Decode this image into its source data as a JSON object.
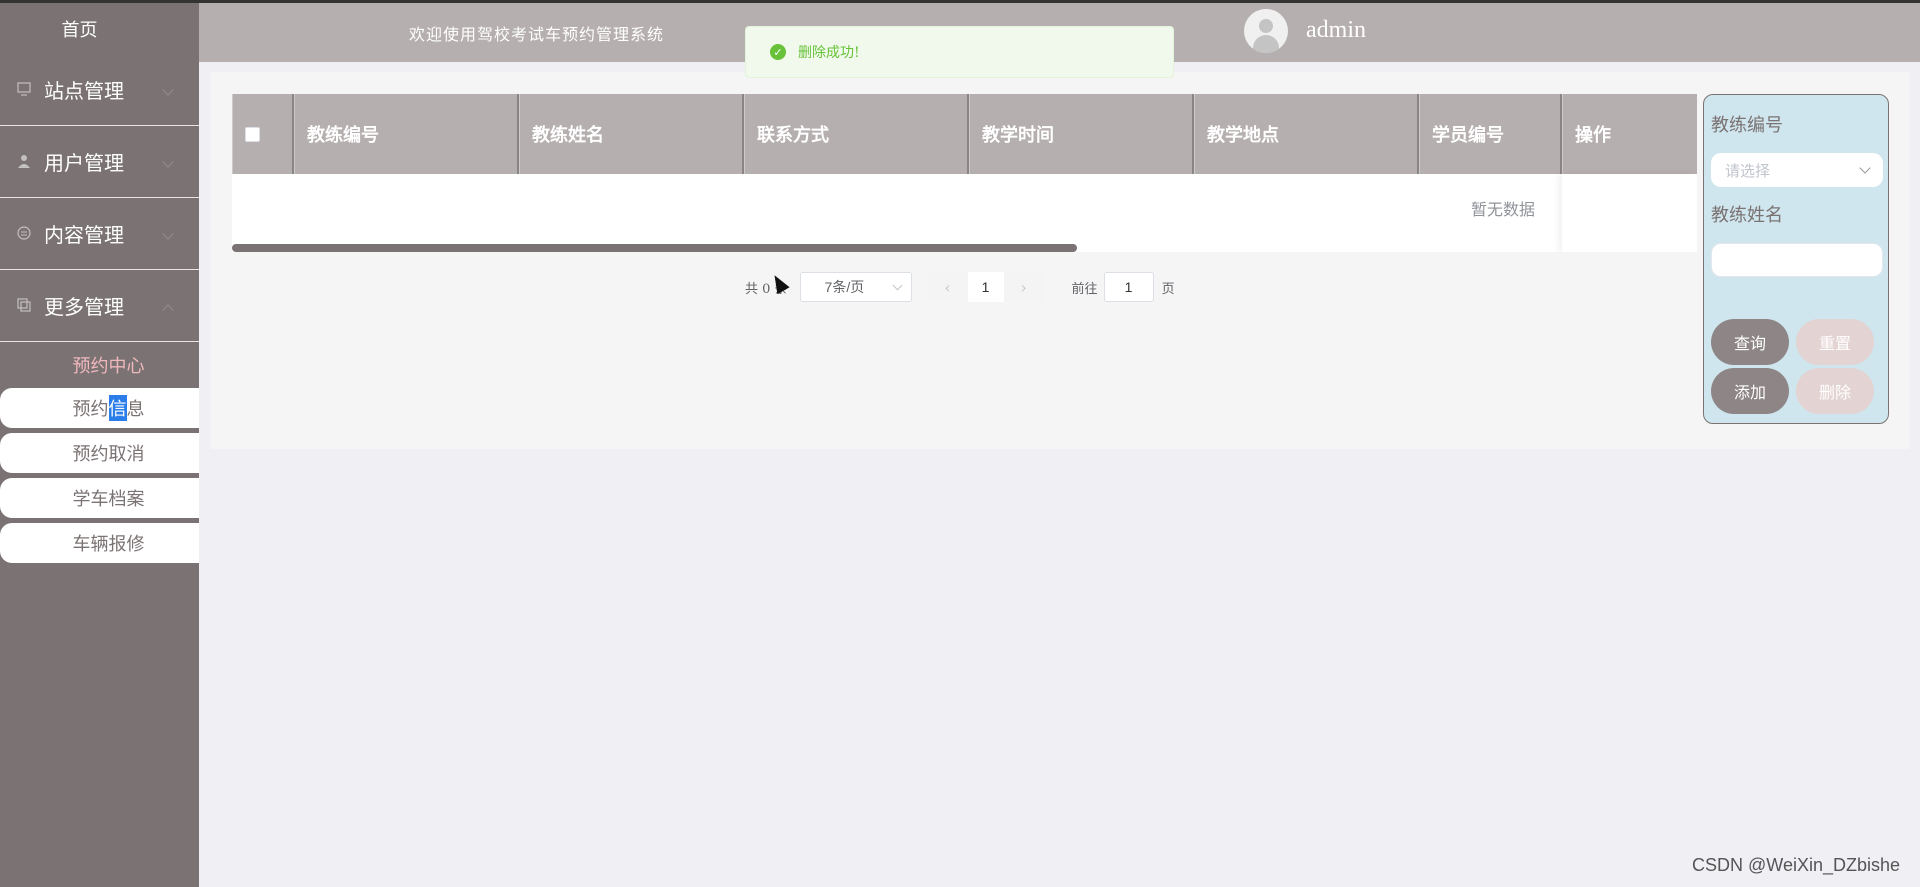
{
  "app": {
    "welcome": "欢迎使用驾校考试车预约管理系统",
    "username": "admin"
  },
  "sidebar": {
    "home": "首页",
    "menus": [
      {
        "label": "站点管理",
        "icon": "monitor-icon"
      },
      {
        "label": "用户管理",
        "icon": "user-icon"
      },
      {
        "label": "内容管理",
        "icon": "message-icon"
      },
      {
        "label": "更多管理",
        "icon": "copy-icon"
      }
    ],
    "submenu_title": "预约中心",
    "submenu_items": [
      {
        "pre": "预约",
        "sel": "信",
        "post": "息"
      },
      {
        "label": "预约取消"
      },
      {
        "label": "学车档案"
      },
      {
        "label": "车辆报修"
      }
    ]
  },
  "toast": {
    "message": "删除成功!",
    "color": "#67c23a"
  },
  "table": {
    "columns": [
      "教练编号",
      "教练姓名",
      "联系方式",
      "教学时间",
      "教学地点",
      "学员编号",
      "操作"
    ],
    "empty_text": "暂无数据",
    "header_color": "#b6afaf"
  },
  "pagination": {
    "total": "共 0 条",
    "page_size": "7条/页",
    "current_page": "1",
    "goto_label": "前往",
    "goto_value": "1",
    "page_suffix": "页"
  },
  "search": {
    "coach_id_label": "教练编号",
    "coach_id_placeholder": "请选择",
    "coach_name_label": "教练姓名",
    "query": "查询",
    "reset": "重置",
    "add": "添加",
    "delete": "删除"
  },
  "watermark": "CSDN @WeiXin_DZbishe"
}
